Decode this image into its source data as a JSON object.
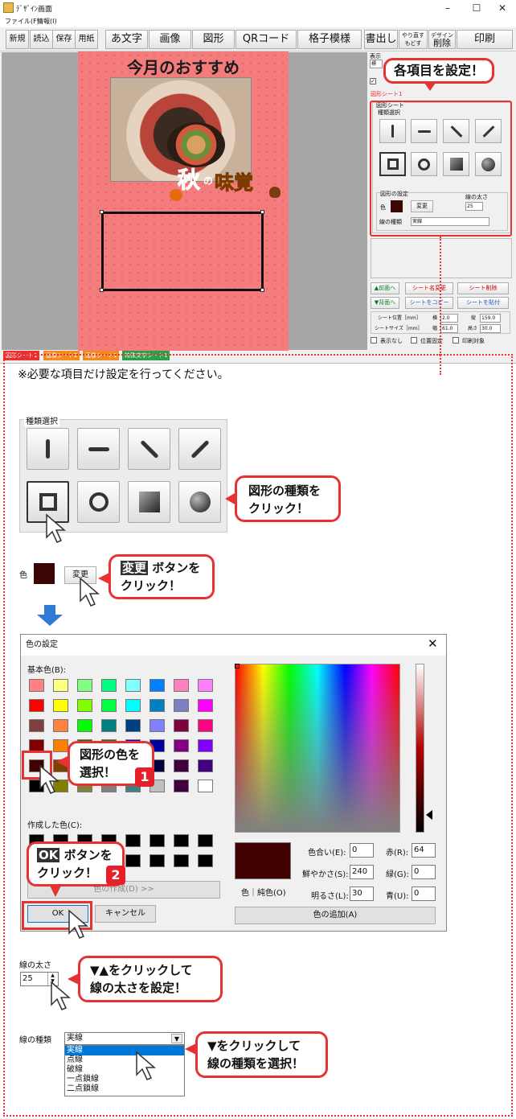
{
  "window": {
    "title": "ﾃﾞｻﾞｲﾝ画面",
    "controls": [
      "–",
      "☐",
      "✕"
    ],
    "menu": [
      "ファイル(F)",
      "情報(I)"
    ]
  },
  "toolbar": {
    "new": "新規",
    "load": "読込",
    "save": "保存",
    "paper": "用紙",
    "text": "あ文字",
    "image": "画像",
    "shape": "図形",
    "qr": "QRコード",
    "grid": "格子模様",
    "export": "書出し",
    "undo1": "やり直す",
    "undo2": "もどす",
    "delete1": "デザイン",
    "delete2": "削除",
    "print": "印刷"
  },
  "canvas": {
    "title": "今月のおすすめ",
    "logo_aki": "秋",
    "logo_no": "の",
    "logo_mikaku": "味覚"
  },
  "sheet_tabs": [
    "図形シート1",
    "画像シート2",
    "画像シート1",
    "特殊文字シート1"
  ],
  "panel": {
    "display_label": "表示",
    "display_value": "標",
    "sheet_name": "図形シート1",
    "group_title": "図形シート",
    "kind_label": "種類選択",
    "setting_label": "図形の設定",
    "color_label": "色",
    "change_button": "変更",
    "width_label": "線の太さ",
    "width_value": "25",
    "linetype_label": "線の種類",
    "linetype_value": "実線",
    "btn_front": "▲前面へ",
    "btn_back": "▼背面へ",
    "btn_rename": "シート名変更",
    "btn_sheet_delete": "シート削除",
    "btn_copy": "シートをコピー",
    "btn_paste": "シートを貼付",
    "pos_label": "シート位置［mm］",
    "x_label": "横",
    "x_value": "2.0",
    "y_label": "縦",
    "y_value": "159.0",
    "size_label": "シートサイズ［mm］",
    "w_label": "幅",
    "w_value": "61.0",
    "h_label": "高さ",
    "h_value": "30.0",
    "chk_hide": "表示なし",
    "chk_fix": "位置固定",
    "chk_noprint": "印刷対象"
  },
  "callouts": {
    "set_items": "各項目を設定！",
    "shape_kind_1": "図形の種類を",
    "shape_kind_2": "クリック！",
    "change_1": "変更",
    "change_2": "ボタンを",
    "change_3": "クリック！",
    "pick_color_1": "図形の色を",
    "pick_color_2": "選択！",
    "ok_1": "OK",
    "ok_2": "ボタンを",
    "ok_3": "クリック！",
    "width_1": "▼▲をクリックして",
    "width_2": "線の太さを設定！",
    "linetype_1": "▼をクリックして",
    "linetype_2": "線の種類を選択！",
    "step1": "1",
    "step2": "2"
  },
  "note": "※必要な項目だけ設定を行ってください。",
  "kind_panel": {
    "legend": "種類選択"
  },
  "color_row": {
    "label": "色",
    "button": "変更",
    "swatch": "#3a0505"
  },
  "dialog": {
    "title": "色の設定",
    "basic_colors": "基本色(B):",
    "custom_colors": "作成した色(C):",
    "define_custom": "色の作成(D) >>",
    "ok": "OK",
    "cancel": "キャンセル",
    "color_solid": "色｜純色(O)",
    "hue_label": "色合い(E):",
    "hue": "0",
    "sat_label": "鮮やかさ(S):",
    "sat": "240",
    "lum_label": "明るさ(L):",
    "lum": "30",
    "red_label": "赤(R):",
    "red": "64",
    "green_label": "緑(G):",
    "green": "0",
    "blue_label": "青(U):",
    "blue": "0",
    "add_custom": "色の追加(A)",
    "palette": [
      "#ff8080",
      "#ffff80",
      "#80ff80",
      "#00ff80",
      "#80ffff",
      "#0080ff",
      "#ff80c0",
      "#ff80ff",
      "#ff0000",
      "#ffff00",
      "#80ff00",
      "#00ff40",
      "#00ffff",
      "#0080c0",
      "#8080c0",
      "#ff00ff",
      "#804040",
      "#ff8040",
      "#00ff00",
      "#008080",
      "#004080",
      "#8080ff",
      "#800040",
      "#ff0080",
      "#800000",
      "#ff8000",
      "#008000",
      "#008040",
      "#0000ff",
      "#0000a0",
      "#800080",
      "#8000ff",
      "#400000",
      "#804000",
      "#004000",
      "#004040",
      "#000080",
      "#000040",
      "#400040",
      "#400080",
      "#000000",
      "#808000",
      "#808040",
      "#808080",
      "#408080",
      "#c0c0c0",
      "#400040",
      "#ffffff"
    ],
    "preview_color": "#400000"
  },
  "width_row": {
    "label": "線の太さ",
    "value": "25"
  },
  "linetype_row": {
    "label": "線の種類",
    "value": "実線",
    "options": [
      "実線",
      "点線",
      "破線",
      "一点鎖線",
      "二点鎖線"
    ]
  },
  "colors": {
    "accent": "#e63232",
    "step_badge": "#e6202a"
  }
}
